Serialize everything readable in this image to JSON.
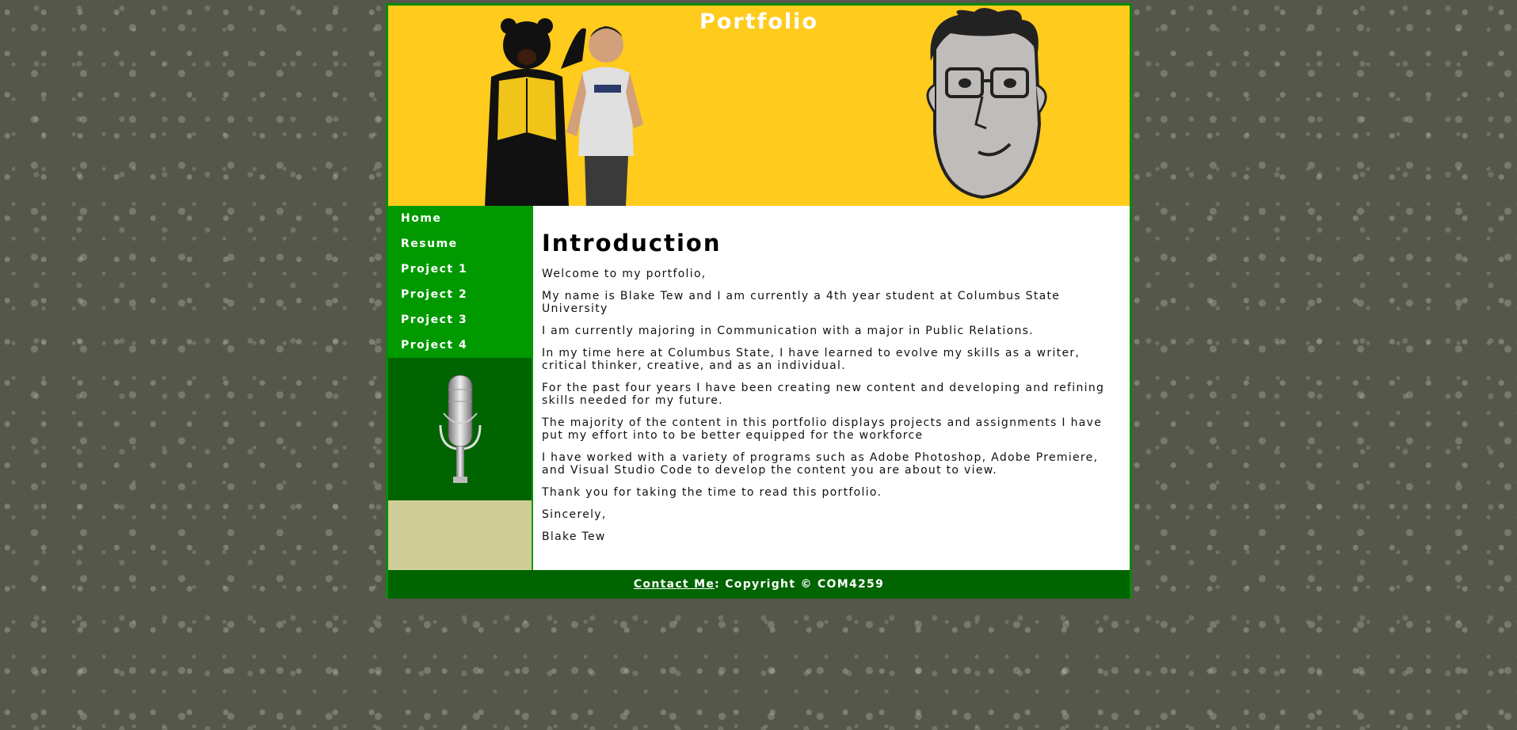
{
  "header": {
    "title": "Portfolio"
  },
  "nav": {
    "items": [
      {
        "label": "Home"
      },
      {
        "label": "Resume"
      },
      {
        "label": "Project 1"
      },
      {
        "label": "Project 2"
      },
      {
        "label": "Project 3"
      },
      {
        "label": "Project 4"
      }
    ]
  },
  "main": {
    "heading": "Introduction",
    "paragraphs": [
      "Welcome to my portfolio,",
      "My name is Blake Tew and I am currently a 4th year student at Columbus State University",
      "I am currently majoring in Communication with a major in Public Relations.",
      "In my time here at Columbus State, I have learned to evolve my skills as a writer, critical thinker, creative, and as an individual.",
      "For the past four years I have been creating new content and developing and refining skills needed for my future.",
      "The majority of the content in this portfolio displays projects and assignments I have put my effort into to be better equipped for the workforce",
      "I have worked with a variety of programs such as Adobe Photoshop, Adobe Premiere, and Visual Studio Code to develop the content you are about to view.",
      "Thank you for taking the time to read this portfolio.",
      "Sincerely,",
      "Blake Tew"
    ]
  },
  "footer": {
    "contact_label": "Contact Me",
    "copyright": ": Copyright © COM4259"
  },
  "colors": {
    "header_bg": "#ffcb1d",
    "nav_bg": "#009a00",
    "dark_green": "#006400",
    "tan": "#cfce98",
    "page_bg": "#55574a"
  },
  "images": {
    "header_photo": "mascot-and-student-photo",
    "header_caricature": "caricature-drawing",
    "sidebar": "microphone-icon"
  }
}
